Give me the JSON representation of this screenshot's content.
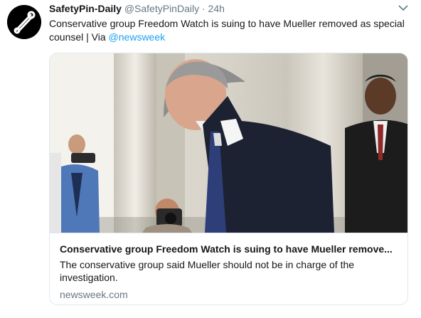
{
  "tweet": {
    "display_name": "SafetyPin-Daily",
    "handle": "@SafetyPinDaily",
    "separator": "·",
    "time": "24h",
    "text": "Conservative group Freedom Watch is suing to have Mueller removed as special counsel | Via ",
    "mention": "@newsweek",
    "avatar_icon": "safety-pin-logo",
    "more_icon": "chevron-down-icon"
  },
  "card": {
    "title": "Conservative group Freedom Watch is suing to have Mueller remove...",
    "description": "The conservative group said Mueller should not be in charge of the investigation.",
    "domain": "newsweek.com",
    "image_icon": "news-photo"
  },
  "colors": {
    "link": "#1da1f2",
    "secondary_text": "#657786",
    "border": "#e1e8ed"
  }
}
